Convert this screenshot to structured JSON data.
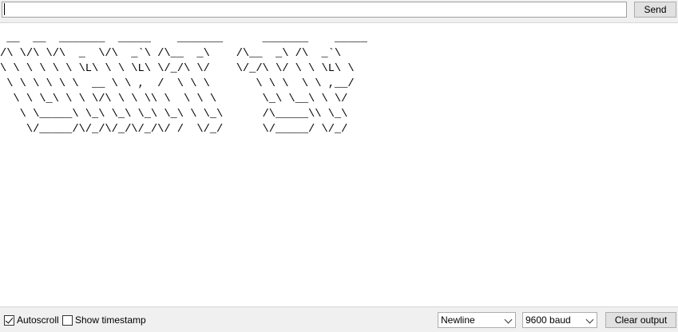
{
  "top": {
    "input_value": "",
    "send_label": "Send"
  },
  "output": {
    "text": " __  __  _______  _____    _______      _______    _____\n/\\ \\/\\ \\/\\  _  \\/\\  _`\\ /\\__  _\\    /\\__  _\\ /\\  _`\\\n\\ \\ \\ \\ \\ \\ \\L\\ \\ \\ \\L\\ \\/_/\\ \\/    \\/_/\\ \\/ \\ \\ \\L\\ \\\n \\ \\ \\ \\ \\ \\  __ \\ \\ ,  /  \\ \\ \\       \\ \\ \\  \\ \\ ,__/\n  \\ \\ \\_\\ \\ \\ \\/\\ \\ \\ \\\\ \\  \\ \\ \\       \\_\\ \\__\\ \\ \\/\n   \\ \\_____\\ \\_\\ \\_\\ \\_\\ \\_\\ \\ \\_\\      /\\_____\\\\ \\_\\\n    \\/_____/\\/_/\\/_/\\/_/\\/ /  \\/_/      \\/_____/ \\/_/"
  },
  "bottom": {
    "autoscroll_label": "Autoscroll",
    "autoscroll_checked": true,
    "timestamp_label": "Show timestamp",
    "timestamp_checked": false,
    "line_ending": "Newline",
    "baud_rate": "9600 baud",
    "clear_label": "Clear output"
  }
}
